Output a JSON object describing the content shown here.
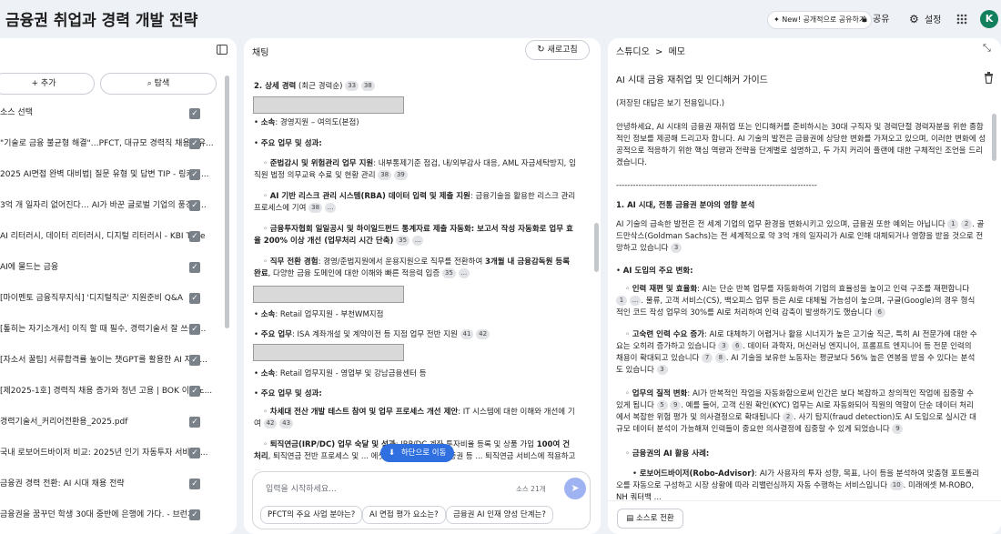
{
  "topbar": {
    "title": "금융권 취업과 경력 개발 전략",
    "new_pill": "New! 공개적으로 공유하기",
    "share": "공유",
    "settings": "설정",
    "avatar_letter": "K"
  },
  "sources": {
    "add": "+ 추가",
    "explore": "탐색",
    "select_all": "소스 선택",
    "items": [
      "\"기술로 금융 불균형 해결\"…PFCT, 대규모 경력직 채용 - 유...",
      "2025 AI면접 완벽 대비법| 질문 유형 및 답변 TIP - 링커리...",
      "3억 개 일자리 없어진다… AI가 바꾼 글로벌 기업의 풍경 -...",
      "AI 리터러시, 데이터 리터러시, 디지털 리터러시 - KBI Tube",
      "AI에 물드는 금융",
      "[마이멘토 금융직무지식] '디지털직군' 지원준비 Q&A",
      "[톺히는 자기소개서] 이직 할 때 필수, 경력기술서 잘 쓰는 ...",
      "[자소서 꿀팁] 서류합격률 높이는 챗GPT를 활용한 AI 자소...",
      "[제2025-1호] 경력직 채용 증가와 청년 고용 | BOK 이슈노...",
      "경력기술서_커리어전환용_2025.pdf",
      "국내 로보어드바이저 비교: 2025년 인기 자동투자 서비스 ...",
      "금융권 경력 전환: AI 시대 채용 전략",
      "금융권을 꿈꾸던 학생 30대 중반에 은행에 가다. - 브런치"
    ]
  },
  "chat": {
    "title": "채팅",
    "refresh": "새로고침",
    "heading": "2. 상세 경력",
    "heading_sub": "(최근 경력순)",
    "heading_cites": [
      "33",
      "38"
    ],
    "b1_dept_label": "소속",
    "b1_dept": ": 경영지원 – 여의도(본점)",
    "b1_duty": "주요 업무 및 성과:",
    "b1_i1_bold": "준법감시 및 위험관리 업무 지원",
    "b1_i1_text": ": 내부통제기준 점검, 내/외부감사 대응, AML 자금세탁방지, 임직원 법정 의무교육 수료 및 현황 관리",
    "b1_i1_cites": [
      "38",
      "39"
    ],
    "b1_i2_bold": "AI 기반 리스크 관리 시스템(RBA) 데이터 입력 및 제출 지원",
    "b1_i2_text": ": 금융기술을 활용한 리스크 관리 프로세스에 기여",
    "b1_i2_cites": [
      "38",
      "..."
    ],
    "b1_i3_bold": "금융투자협회 일일공시 및 하이일드펀드 통계자료 제출 자동화: 보고서 작성 자동화로 업무 효율 200% 이상 개선 (업무처리 시간 단축)",
    "b1_i3_cites": [
      "35",
      "..."
    ],
    "b1_i4_bold": "직무 전환 경험",
    "b1_i4_text": ": 경영/준법지원에서 운용지원으로 직무를 전환하여 ",
    "b1_i4_bold2": "3개월 내 금융감독원 등록 완료",
    "b1_i4_text2": ", 다양한 금융 도메인에 대한 이해와 빠른 적응력 입증",
    "b1_i4_cites": [
      "35",
      "..."
    ],
    "b2_dept_label": "소속",
    "b2_dept": ": Retail 업무지원 - 부천WM지점",
    "b2_duty_label": "주요 업무",
    "b2_duty": ": ISA 계좌개설 및 계약이전 등 지점 업무 전반 지원",
    "b2_cites": [
      "41",
      "42"
    ],
    "b3_dept_label": "소속",
    "b3_dept": ": Retail 업무지원 - 영업부 및 강남금융센터 등",
    "b3_duty": "주요 업무 및 성과:",
    "b3_i1_bold": "차세대 전산 개발 테스트 참여 및 업무 프로세스 개선 제안",
    "b3_i1_text": ": IT 시스템에 대한 이해와 개선에 기여",
    "b3_i1_cites": [
      "42",
      "43"
    ],
    "b3_i2_bold": "퇴직연금(IRP/DC) 업무 숙달 및 성과",
    "b3_i2_text": ": IRP/DC 계좌 투자비율 등록 및 상품 가입 ",
    "b3_i2_bold2": "100여 건 처리",
    "b3_i2_text2": ", 퇴직연금 전반 프로세스 및 ... 에셋자산운용과 NH투자증권 등 ... 퇴직연금 서비스에 적용하고 ...",
    "scroll_down": "하단으로 이동",
    "input_placeholder": "입력을 시작하세요...",
    "source_count": "소스 21개",
    "suggestions": [
      "PFCT의 주요 사업 분야는?",
      "AI 면접 평가 요소는?",
      "금융권 AI 인재 양성 단계는?"
    ]
  },
  "studio": {
    "crumb_root": "스튜디오",
    "crumb_sep": ">",
    "crumb_page": "메모",
    "note_title": "AI 시대 금융 재취업 및 인디해커 가이드",
    "readonly": "(저장된 대답은 보기 전용입니다.)",
    "intro": "안녕하세요, AI 시대의 금융권 재취업 또는 인디해커를 준비하시는 30대 구직자 및 경력단절 경력자분을 위한 종합적인 정보를 제공해 드리고자 합니다. AI 기술의 발전은 금융권에 상당한 변화를 가져오고 있으며, 이러한 변화에 성공적으로 적응하기 위한 핵심 역량과 전략을 단계별로 설명하고, 두 가지 커리어 플랜에 대한 구체적인 조언을 드리겠습니다.",
    "divider": "------------------------------------------------------------------------",
    "s1_title": "1. AI 시대, 전통 금융권 분야의 영향 분석",
    "s1_text": "AI 기술의 급속한 발전은 전 세계 기업의 업무 환경을 변화시키고 있으며, 금융권 또한 예외는 아닙니다",
    "s1_cites_a": [
      "1",
      "2"
    ],
    "s1_text2": ". 골드만삭스(Goldman Sachs)는 전 세계적으로 약 3억 개의 일자리가 AI로 인해 대체되거나 영향을 받을 것으로 전망하고 있습니다",
    "s1_cites_b": [
      "3"
    ],
    "s1_sub": "AI 도입의 주요 변화:",
    "p1_bold": "인력 재편 및 효율화",
    "p1_text": ": AI는 단순 반복 업무를 자동화하여 기업의 효율성을 높이고 인력 구조를 재편합니다",
    "p1_cites_a": [
      "1",
      "..."
    ],
    "p1_text2": ". 물류, 고객 서비스(CS), 백오피스 업무 등은 AI로 대체될 가능성이 높으며, 구글(Google)의 경우 형식적인 코드 작성 업무의 30%를 AI로 처리하여 인력 감축이 발생하기도 했습니다",
    "p1_cites_b": [
      "6"
    ],
    "p2_bold": "고숙련 인력 수요 증가",
    "p2_text": ": AI로 대체하기 어렵거나 활용 시너지가 높은 고기술 직군, 특히 AI 전문가에 대한 수요는 오히려 증가하고 있습니다",
    "p2_cites_a": [
      "3",
      "6"
    ],
    "p2_text2": ". 데이터 과학자, 머신러닝 엔지니어, 프롬프트 엔지니어 등 전문 인력의 채용이 확대되고 있습니다",
    "p2_cites_b": [
      "7",
      "8"
    ],
    "p2_text3": ". AI 기술을 보유한 노동자는 평균보다 56% 높은 연봉을 받을 수 있다는 분석도 있습니다",
    "p2_cites_c": [
      "3"
    ],
    "p3_bold": "업무의 질적 변화",
    "p3_text": ": AI가 반복적인 작업을 자동화함으로써 인간은 보다 복잡하고 창의적인 작업에 집중할 수 있게 됩니다",
    "p3_cites_a": [
      "5",
      "9"
    ],
    "p3_text2": ". 예를 들어, 고객 신원 확인(KYC) 업무는 AI로 자동화되어 직원의 역할이 단순 데이터 처리에서 복잡한 위험 평가 및 의사결정으로 확대됩니다",
    "p3_cites_b": [
      "2"
    ],
    "p3_text3": ". 사기 탐지(fraud detection)도 AI 도입으로 실시간 대규모 데이터 분석이 가능해져 인력들이 중요한 의사결정에 집중할 수 있게 되었습니다",
    "p3_cites_c": [
      "9"
    ],
    "p4_bold": "금융권의 AI 활용 사례:",
    "p5_bold": "로보어드바이저(Robo-Advisor)",
    "p5_text": ": AI가 사용자의 투자 성향, 목표, 나이 등을 분석하여 맞춤형 포트폴리오를 자동으로 구성하고 시장 상황에 따라 리밸런싱까지 자동 수행하는 서비스입니다",
    "p5_cites": [
      "10"
    ],
    "p5_text2": ". 미래에셋 M-ROBO, NH 쿼터백 ...",
    "convert": "소스로 전환"
  }
}
